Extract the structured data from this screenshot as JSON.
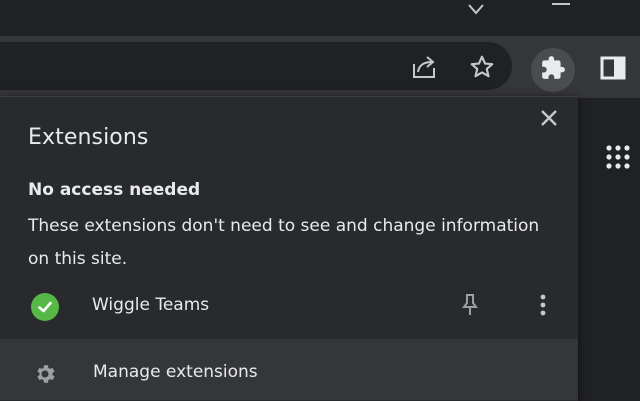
{
  "popup": {
    "title": "Extensions",
    "section_heading": "No access needed",
    "section_description": "These extensions don't need to see and change information on this site.",
    "extensions": [
      {
        "name": "Wiggle Teams",
        "status_icon": "check-circle-icon",
        "status_color": "#56b947"
      }
    ],
    "manage_label": "Manage extensions"
  },
  "colors": {
    "background": "#202124",
    "toolbar": "#35363a",
    "popup": "#292a2d",
    "text": "#e8eaed",
    "accent_green": "#56b947"
  }
}
